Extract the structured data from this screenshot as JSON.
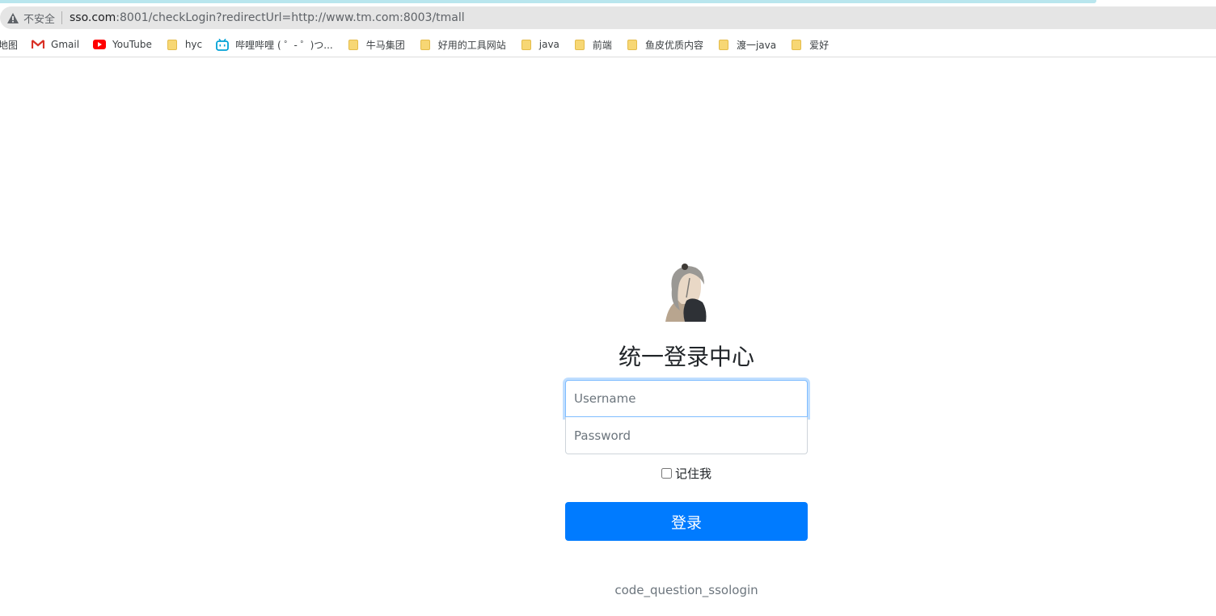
{
  "browser": {
    "insecure_label": "不安全",
    "url_host": "sso.com",
    "url_rest": ":8001/checkLogin?redirectUrl=http://www.tm.com:8003/tmall",
    "bookmarks": [
      {
        "label": "地图",
        "icon": "map-icon"
      },
      {
        "label": "Gmail",
        "icon": "gmail-icon"
      },
      {
        "label": "YouTube",
        "icon": "youtube-icon"
      },
      {
        "label": "hyc",
        "icon": "folder-icon"
      },
      {
        "label": "哔哩哔哩 ( ゜- ゜)つ...",
        "icon": "bilibili-icon"
      },
      {
        "label": "牛马集团",
        "icon": "folder-icon"
      },
      {
        "label": "好用的工具网站",
        "icon": "folder-icon"
      },
      {
        "label": "java",
        "icon": "folder-icon"
      },
      {
        "label": "前端",
        "icon": "folder-icon"
      },
      {
        "label": "鱼皮优质内容",
        "icon": "folder-icon"
      },
      {
        "label": "渡一java",
        "icon": "folder-icon"
      },
      {
        "label": "爱好",
        "icon": "folder-icon"
      }
    ]
  },
  "login": {
    "title": "统一登录中心",
    "username_placeholder": "Username",
    "password_placeholder": "Password",
    "remember_label": "记住我",
    "submit_label": "登录",
    "footer_text": "code_question_ssologin"
  },
  "colors": {
    "primary": "#007bff",
    "focus_border": "#80bdff"
  }
}
